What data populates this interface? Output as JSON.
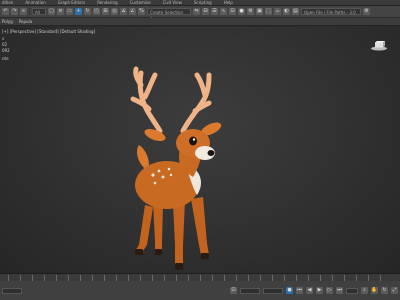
{
  "menubar": {
    "items": [
      "dition",
      "Animation",
      "Graph Editors",
      "Rendering",
      "Customize",
      "Civil View",
      "Scripting",
      "Help"
    ]
  },
  "toolbar": {
    "selection_filter": "All",
    "named_selection": "Create Selection Se",
    "workspace": "Open File / File Paths - 3.0"
  },
  "subbar": {
    "items": [
      "Polyg",
      "Popula"
    ]
  },
  "viewport": {
    "label": "[+] [Perspective] [Standard] [Default Shading]",
    "stats": [
      "s",
      "02",
      "092",
      "nte"
    ]
  },
  "colors": {
    "accent": "#2d6fa8",
    "deer_body": "#c86a22",
    "antler": "#f2b48a"
  }
}
